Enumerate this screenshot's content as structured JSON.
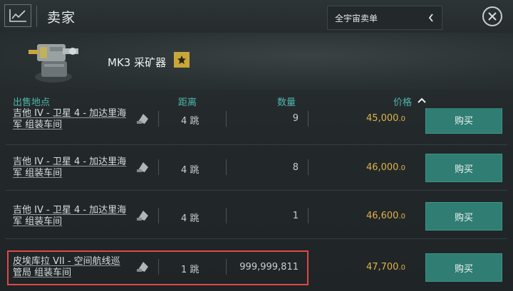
{
  "header": {
    "title": "卖家",
    "scope_select": "全宇宙卖单"
  },
  "item": {
    "name": "MK3 采矿器",
    "badge_icon": "star-icon"
  },
  "columns": {
    "location": "出售地点",
    "distance": "距离",
    "quantity": "数量",
    "price": "价格"
  },
  "orders": [
    {
      "loc1": "吉他 IV - 卫星 4 - 加达里海",
      "loc2": "军 组装车间",
      "jumps": "4 跳",
      "qty": "9",
      "price": "45,000",
      "price_dec": ".0",
      "buy": "购买"
    },
    {
      "loc1": "吉他 IV - 卫星 4 - 加达里海",
      "loc2": "军 组装车间",
      "jumps": "4 跳",
      "qty": "8",
      "price": "46,000",
      "price_dec": ".0",
      "buy": "购买"
    },
    {
      "loc1": "吉他 IV - 卫星 4 - 加达里海",
      "loc2": "军 组装车间",
      "jumps": "4 跳",
      "qty": "1",
      "price": "46,600",
      "price_dec": ".0",
      "buy": "购买"
    },
    {
      "loc1": "皮埃库拉 VII - 空间航线巡",
      "loc2": "管局 组装车间",
      "jumps": "1 跳",
      "qty": "999,999,811",
      "price": "47,700",
      "price_dec": ".0",
      "buy": "购买"
    }
  ],
  "colors": {
    "accent": "#4fb5ad",
    "price": "#e0b24a",
    "buy_button": "#2f7d73",
    "highlight": "#e04848"
  }
}
